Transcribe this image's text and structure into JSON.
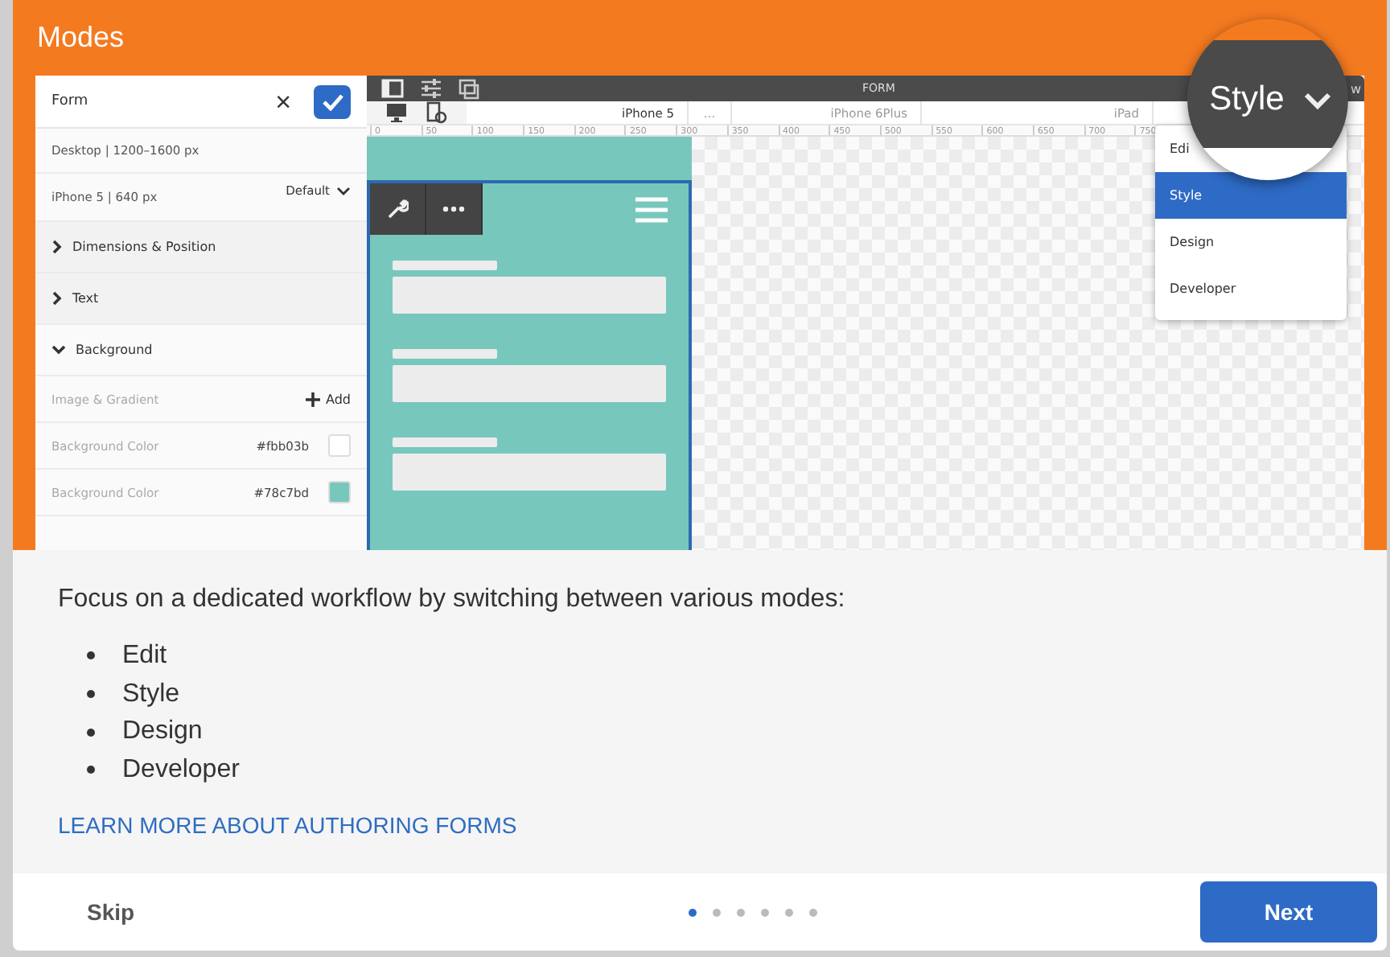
{
  "dialog": {
    "title": "Modes"
  },
  "preview": {
    "panel": {
      "title": "Form",
      "close": "×",
      "breakpoints": [
        {
          "label": "Desktop | 1200–1600 px"
        },
        {
          "label": "iPhone 5 | 640 px",
          "option": "Default"
        }
      ],
      "sections": [
        {
          "label": "Dimensions & Position",
          "expanded": false
        },
        {
          "label": "Text",
          "expanded": false
        },
        {
          "label": "Background",
          "expanded": true
        }
      ],
      "image_row": {
        "label": "Image & Gradient",
        "action": "Add"
      },
      "color_rows": [
        {
          "label": "Background Color",
          "value": "#fbb03b",
          "color": "#ffffff"
        },
        {
          "label": "Background Color",
          "value": "#78c7bd",
          "color": "#78c7bd"
        }
      ]
    },
    "toolbar": {
      "title": "FORM",
      "right_text": "w"
    },
    "devices": [
      {
        "label": "iPhone 5"
      },
      {
        "label": "..."
      },
      {
        "label": "iPhone 6Plus"
      },
      {
        "label": "iPad"
      }
    ],
    "ruler": [
      "0",
      "50",
      "100",
      "150",
      "200",
      "250",
      "300",
      "350",
      "400",
      "450",
      "500",
      "550",
      "600",
      "650",
      "700",
      "750"
    ],
    "mode_menu": {
      "current": "Style",
      "items": [
        {
          "label": "Edi",
          "selected": false
        },
        {
          "label": "Style",
          "selected": true
        },
        {
          "label": "Design",
          "selected": false
        },
        {
          "label": "Developer",
          "selected": false
        }
      ]
    }
  },
  "info": {
    "text": "Focus on a dedicated workflow by switching between various modes:",
    "modes": [
      "Edit",
      "Style",
      "Design",
      "Developer"
    ],
    "link": "LEARN MORE ABOUT AUTHORING FORMS"
  },
  "footer": {
    "skip": "Skip",
    "next": "Next",
    "pages": [
      {
        "selected": true
      },
      {
        "selected": false
      },
      {
        "selected": false
      },
      {
        "selected": false
      },
      {
        "selected": false
      },
      {
        "selected": false
      }
    ]
  }
}
